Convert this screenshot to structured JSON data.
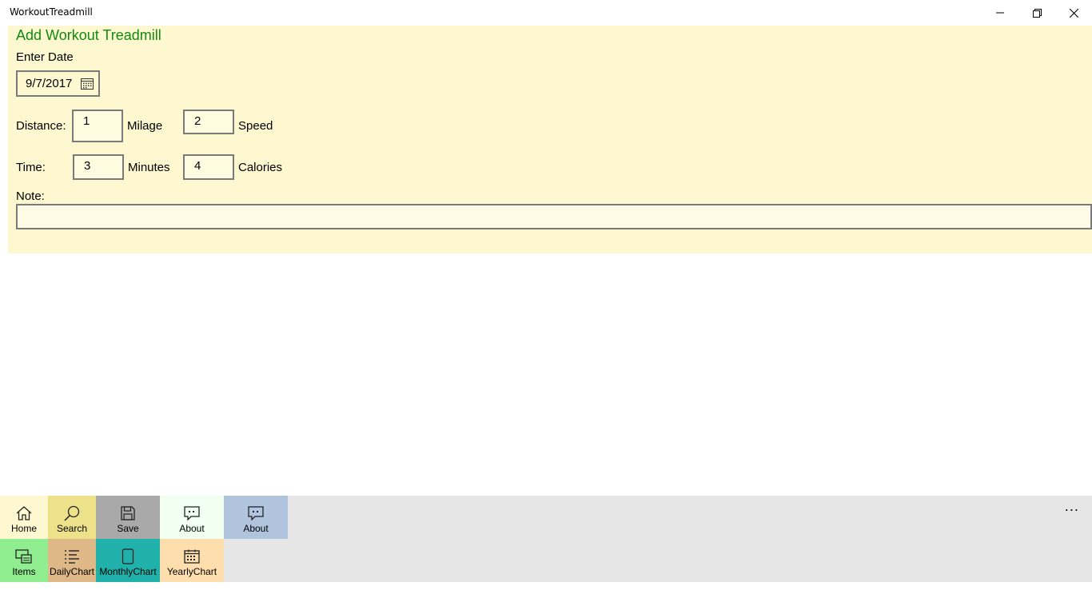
{
  "window": {
    "title": "WorkoutTreadmill",
    "minimize_icon": "minimize-icon",
    "restore_icon": "restore-icon",
    "close_icon": "close-icon"
  },
  "form": {
    "heading": "Add Workout Treadmill",
    "date_label": "Enter Date",
    "date_value": "9/7/2017",
    "distance_label": "Distance:",
    "distance_value": "1",
    "mileage_label": "Milage",
    "speed_value": "2",
    "speed_label": "Speed",
    "time_label": "Time:",
    "time_value": "3",
    "minutes_label": "Minutes",
    "calories_value": "4",
    "calories_label": "Calories",
    "note_label": "Note:",
    "note_value": ""
  },
  "commandbar": {
    "more_label": "...",
    "row1": [
      {
        "label": "Home",
        "icon": "home-icon",
        "color": "#fdf8d0"
      },
      {
        "label": "Search",
        "icon": "search-icon",
        "color": "#ede28a"
      },
      {
        "label": "Save",
        "icon": "save-icon",
        "color": "#a9a9a9"
      },
      {
        "label": "About",
        "icon": "chat-icon",
        "color": "#f0fff0"
      },
      {
        "label": "About",
        "icon": "chat-icon",
        "color": "#b0c4de"
      }
    ],
    "row2": [
      {
        "label": "Items",
        "icon": "items-icon",
        "color": "#90ee90"
      },
      {
        "label": "DailyChart",
        "icon": "list-icon",
        "color": "#deb887"
      },
      {
        "label": "MonthlyChart",
        "icon": "tablet-icon",
        "color": "#20b2aa"
      },
      {
        "label": "YearlyChart",
        "icon": "calendar-icon",
        "color": "#ffdead"
      }
    ]
  }
}
